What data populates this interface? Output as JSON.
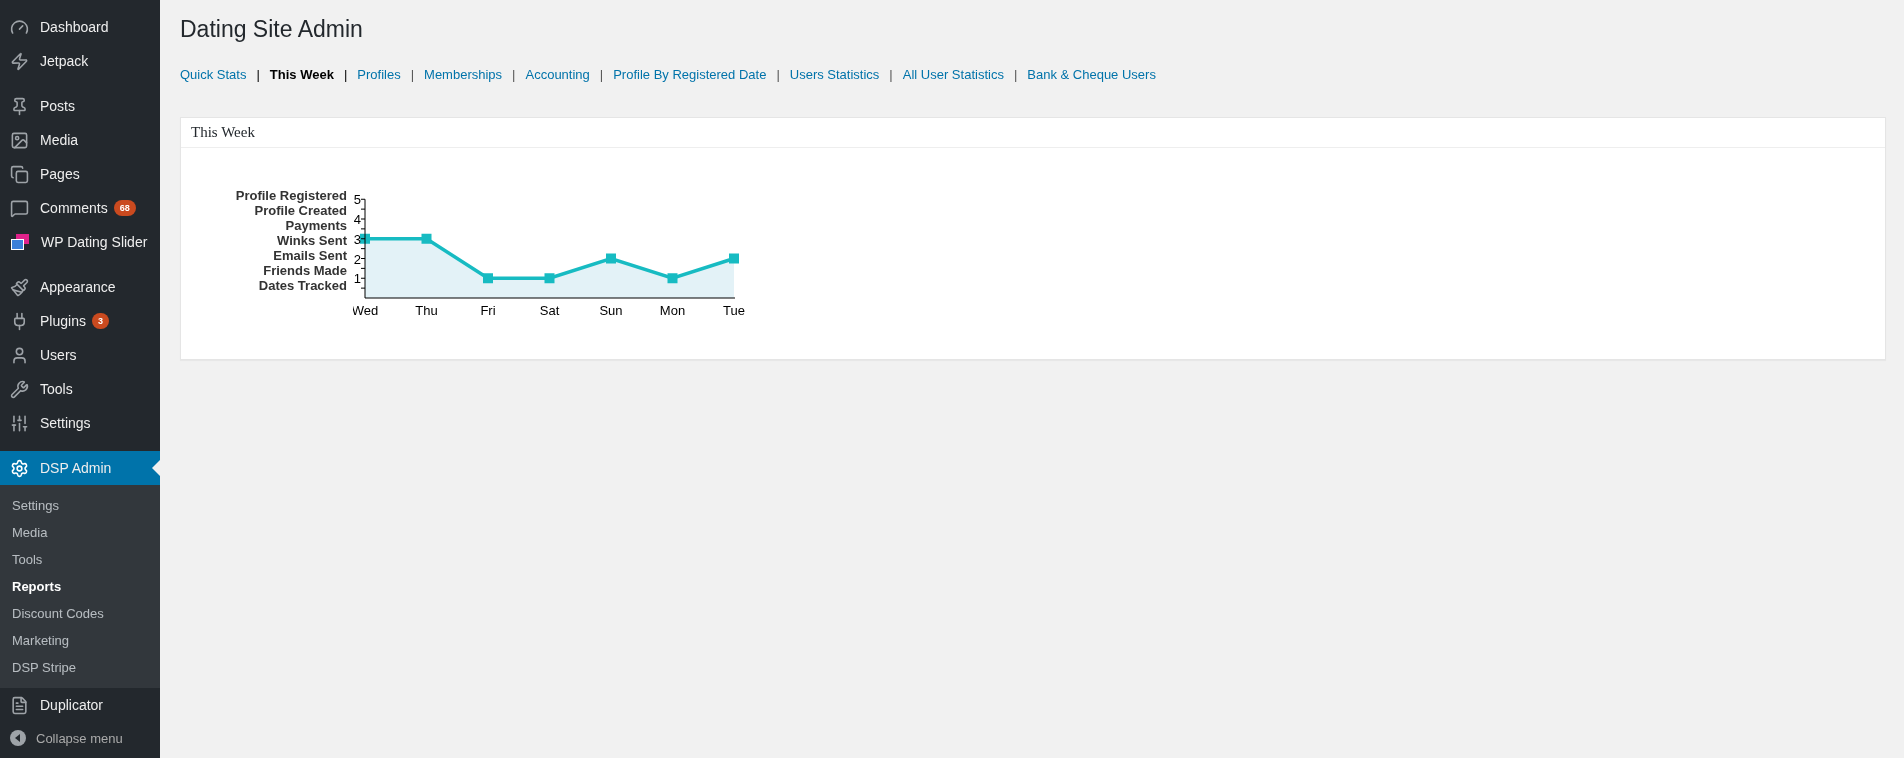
{
  "sidebar": {
    "groups": [
      [
        {
          "label": "Dashboard",
          "selected": false
        },
        {
          "label": "Jetpack",
          "selected": false
        }
      ],
      [
        {
          "label": "Posts",
          "selected": false
        },
        {
          "label": "Media",
          "selected": false
        },
        {
          "label": "Pages",
          "selected": false
        },
        {
          "label": "Comments",
          "badge": "68",
          "selected": false
        },
        {
          "label": "WP Dating Slider",
          "selected": false
        }
      ],
      [
        {
          "label": "Appearance",
          "selected": false
        },
        {
          "label": "Plugins",
          "badge": "3",
          "selected": false
        },
        {
          "label": "Users",
          "selected": false
        },
        {
          "label": "Tools",
          "selected": false
        },
        {
          "label": "Settings",
          "selected": false
        }
      ]
    ],
    "active": {
      "label": "DSP Admin",
      "selected": true,
      "submenu": [
        {
          "label": "Settings",
          "selected": false
        },
        {
          "label": "Media",
          "selected": false
        },
        {
          "label": "Tools",
          "selected": false
        },
        {
          "label": "Reports",
          "selected": true
        },
        {
          "label": "Discount Codes",
          "selected": false
        },
        {
          "label": "Marketing",
          "selected": false
        },
        {
          "label": "DSP Stripe",
          "selected": false
        }
      ]
    },
    "after": [
      {
        "label": "Duplicator",
        "selected": false
      }
    ],
    "collapse": "Collapse menu"
  },
  "page": {
    "title": "Dating Site Admin",
    "tabs": [
      {
        "label": "Quick Stats",
        "selected": false
      },
      {
        "label": "This Week",
        "selected": true
      },
      {
        "label": "Profiles",
        "selected": false
      },
      {
        "label": "Memberships",
        "selected": false
      },
      {
        "label": "Accounting",
        "selected": false
      },
      {
        "label": "Profile By Registered Date",
        "selected": false
      },
      {
        "label": "Users Statistics",
        "selected": false
      },
      {
        "label": "All User Statistics",
        "selected": false
      },
      {
        "label": "Bank & Cheque Users",
        "selected": false
      }
    ],
    "separator": "|",
    "card": {
      "title": "This Week",
      "legend": [
        "Profile Registered",
        "Profile Created",
        "Payments",
        "Winks Sent",
        "Emails Sent",
        "Friends Made",
        "Dates Tracked"
      ],
      "chart_data": {
        "type": "area",
        "categories": [
          "Wed",
          "Thu",
          "Fri",
          "Sat",
          "Sun",
          "Mon",
          "Tue"
        ],
        "values": [
          3,
          3,
          1,
          1,
          2,
          1,
          2
        ],
        "ylim": [
          0,
          5
        ],
        "yticks": [
          1,
          2,
          3,
          4,
          5
        ]
      }
    }
  }
}
